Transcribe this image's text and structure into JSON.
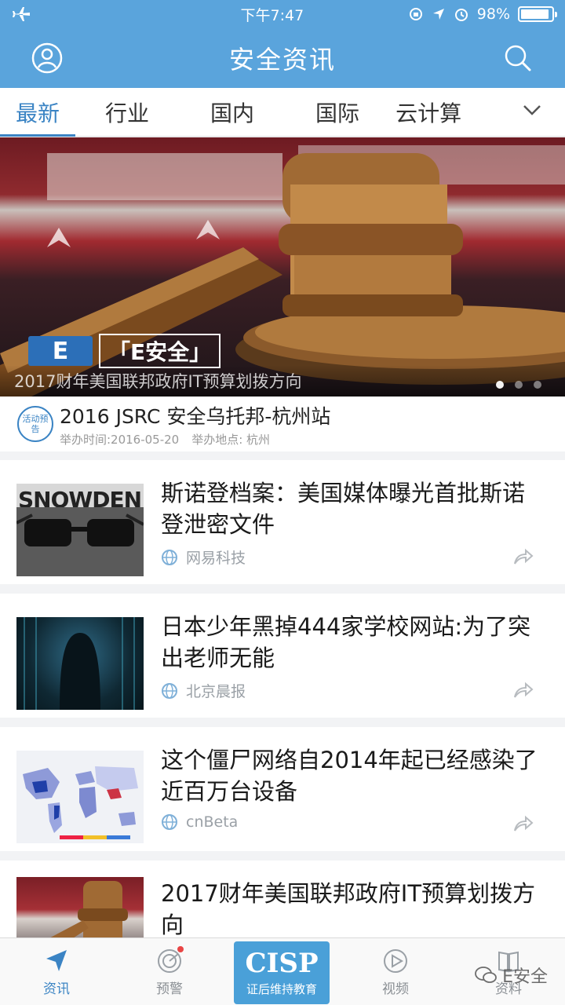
{
  "status_bar": {
    "time": "下午7:47",
    "battery": "98%"
  },
  "header": {
    "title": "安全资讯"
  },
  "tabs": [
    "最新",
    "行业",
    "国内",
    "国际",
    "云计算"
  ],
  "banner": {
    "caption": "2017财年美国联邦政府IT预算划拨方向",
    "logo_letter": "E",
    "logo_text": "「E安全」",
    "slides": 3,
    "active_slide": 1
  },
  "event": {
    "badge": "活动预告",
    "title": "2016 JSRC 安全乌托邦-杭州站",
    "time": "举办时间:2016-05-20",
    "place": "举办地点: 杭州"
  },
  "news": [
    {
      "title": "斯诺登档案：美国媒体曝光首批斯诺登泄密文件",
      "source": "网易科技",
      "thumb_text": "SNOWDEN"
    },
    {
      "title": "日本少年黑掉444家学校网站:为了突出老师无能",
      "source": "北京晨报"
    },
    {
      "title": "这个僵尸网络自2014年起已经感染了近百万台设备",
      "source": "cnBeta"
    },
    {
      "title": "2017财年美国联邦政府IT预算划拨方向",
      "source": ""
    }
  ],
  "bottom_nav": {
    "news": "资讯",
    "alert": "预警",
    "cisp_title": "CISP",
    "cisp_sub": "证后维持教育",
    "video": "视频",
    "docs": "资料"
  },
  "watermark": "E安全",
  "colors": {
    "header": "#5aa4dc",
    "accent": "#3b84c4"
  }
}
